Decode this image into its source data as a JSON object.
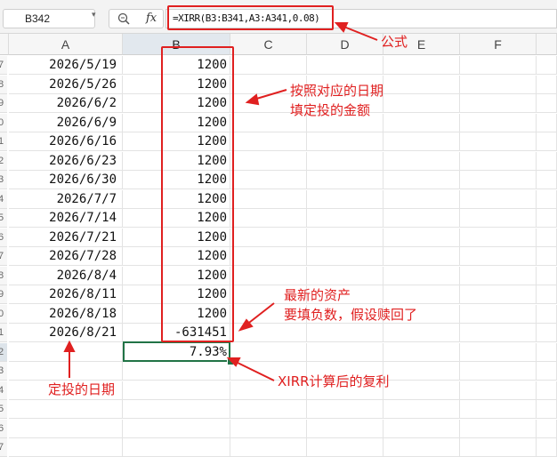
{
  "name_box": {
    "value": "B342"
  },
  "formula_bar": {
    "fx_label": "fx",
    "formula": "=XIRR(B3:B341,A3:A341,0.08)"
  },
  "columns": [
    "A",
    "B",
    "C",
    "D",
    "E",
    "F"
  ],
  "active_column": "B",
  "row_numbers": [
    "7",
    "8",
    "9",
    "0",
    "1",
    "2",
    "3",
    "4",
    "5",
    "6",
    "7",
    "8",
    "9",
    "0",
    "1",
    "2",
    "3",
    "4",
    "5",
    "6",
    "7"
  ],
  "rows": [
    {
      "date": "2026/5/19",
      "amount": "1200"
    },
    {
      "date": "2026/5/26",
      "amount": "1200"
    },
    {
      "date": "2026/6/2",
      "amount": "1200"
    },
    {
      "date": "2026/6/9",
      "amount": "1200"
    },
    {
      "date": "2026/6/16",
      "amount": "1200"
    },
    {
      "date": "2026/6/23",
      "amount": "1200"
    },
    {
      "date": "2026/6/30",
      "amount": "1200"
    },
    {
      "date": "2026/7/7",
      "amount": "1200"
    },
    {
      "date": "2026/7/14",
      "amount": "1200"
    },
    {
      "date": "2026/7/21",
      "amount": "1200"
    },
    {
      "date": "2026/7/28",
      "amount": "1200"
    },
    {
      "date": "2026/8/4",
      "amount": "1200"
    },
    {
      "date": "2026/8/11",
      "amount": "1200"
    },
    {
      "date": "2026/8/18",
      "amount": "1200"
    },
    {
      "date": "2026/8/21",
      "amount": "-631451"
    },
    {
      "date": "",
      "amount": "7.93%"
    },
    {
      "date": "",
      "amount": ""
    },
    {
      "date": "",
      "amount": ""
    },
    {
      "date": "",
      "amount": ""
    },
    {
      "date": "",
      "amount": ""
    },
    {
      "date": "",
      "amount": ""
    }
  ],
  "annotations": {
    "formula": "公式",
    "amounts_line1": "按照对应的日期",
    "amounts_line2": "填定投的金额",
    "latest_line1": "最新的资产",
    "latest_line2": "要填负数，假设赎回了",
    "xirr": "XIRR计算后的复利",
    "dates": "定投的日期"
  },
  "colors": {
    "annotation": "#e02020",
    "selection": "#217346"
  }
}
